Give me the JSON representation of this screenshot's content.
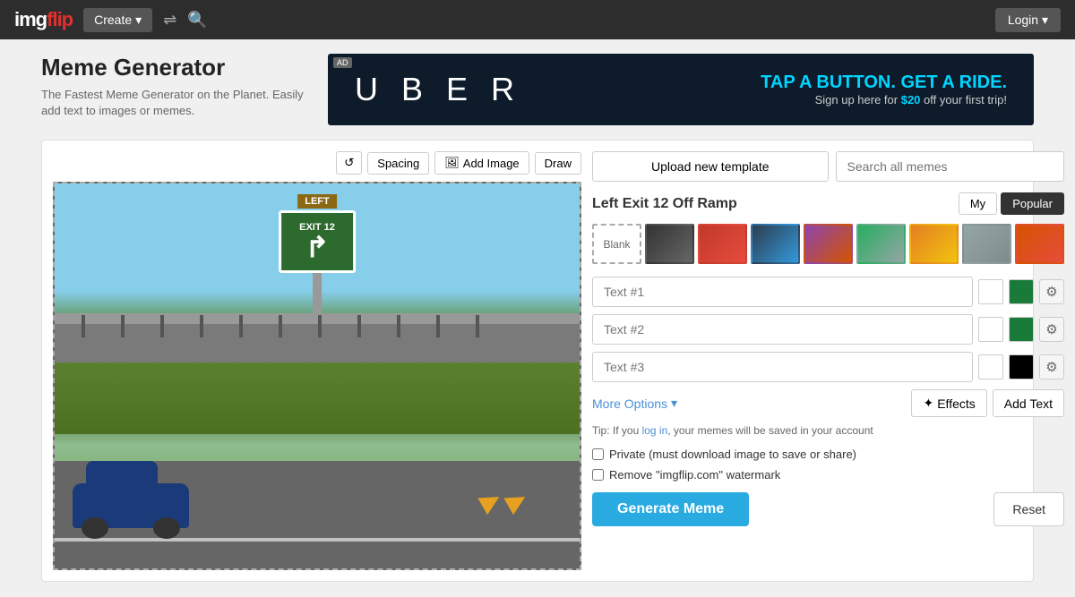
{
  "header": {
    "logo": "imgflip",
    "logo_accent": "img",
    "create_label": "Create",
    "login_label": "Login"
  },
  "page": {
    "title": "Meme Generator",
    "subtitle": "The Fastest Meme Generator on the Planet. Easily add text to images or memes."
  },
  "ad": {
    "label": "AD",
    "logo": "U B E R",
    "headline": "TAP A BUTTON. GET A RIDE.",
    "subtext_pre": "Sign up here for ",
    "price": "$20",
    "subtext_post": " off your first trip!"
  },
  "toolbar": {
    "spacing_label": "Spacing",
    "add_image_label": "Add Image",
    "draw_label": "Draw"
  },
  "right_panel": {
    "upload_label": "Upload new template",
    "search_placeholder": "Search all memes",
    "template_title": "Left Exit 12 Off Ramp",
    "tab_my": "My",
    "tab_popular": "Popular",
    "blank_label": "Blank",
    "text1_placeholder": "Text #1",
    "text2_placeholder": "Text #2",
    "text3_placeholder": "Text #3",
    "more_options_label": "More Options",
    "effects_label": "Effects",
    "add_text_label": "Add Text",
    "tip_text_pre": "Tip: If you ",
    "tip_link": "log in",
    "tip_text_post": ", your memes will be saved in your account",
    "private_label": "Private (must download image to save or share)",
    "watermark_label": "Remove \"imgflip.com\" watermark",
    "generate_label": "Generate Meme",
    "reset_label": "Reset"
  }
}
